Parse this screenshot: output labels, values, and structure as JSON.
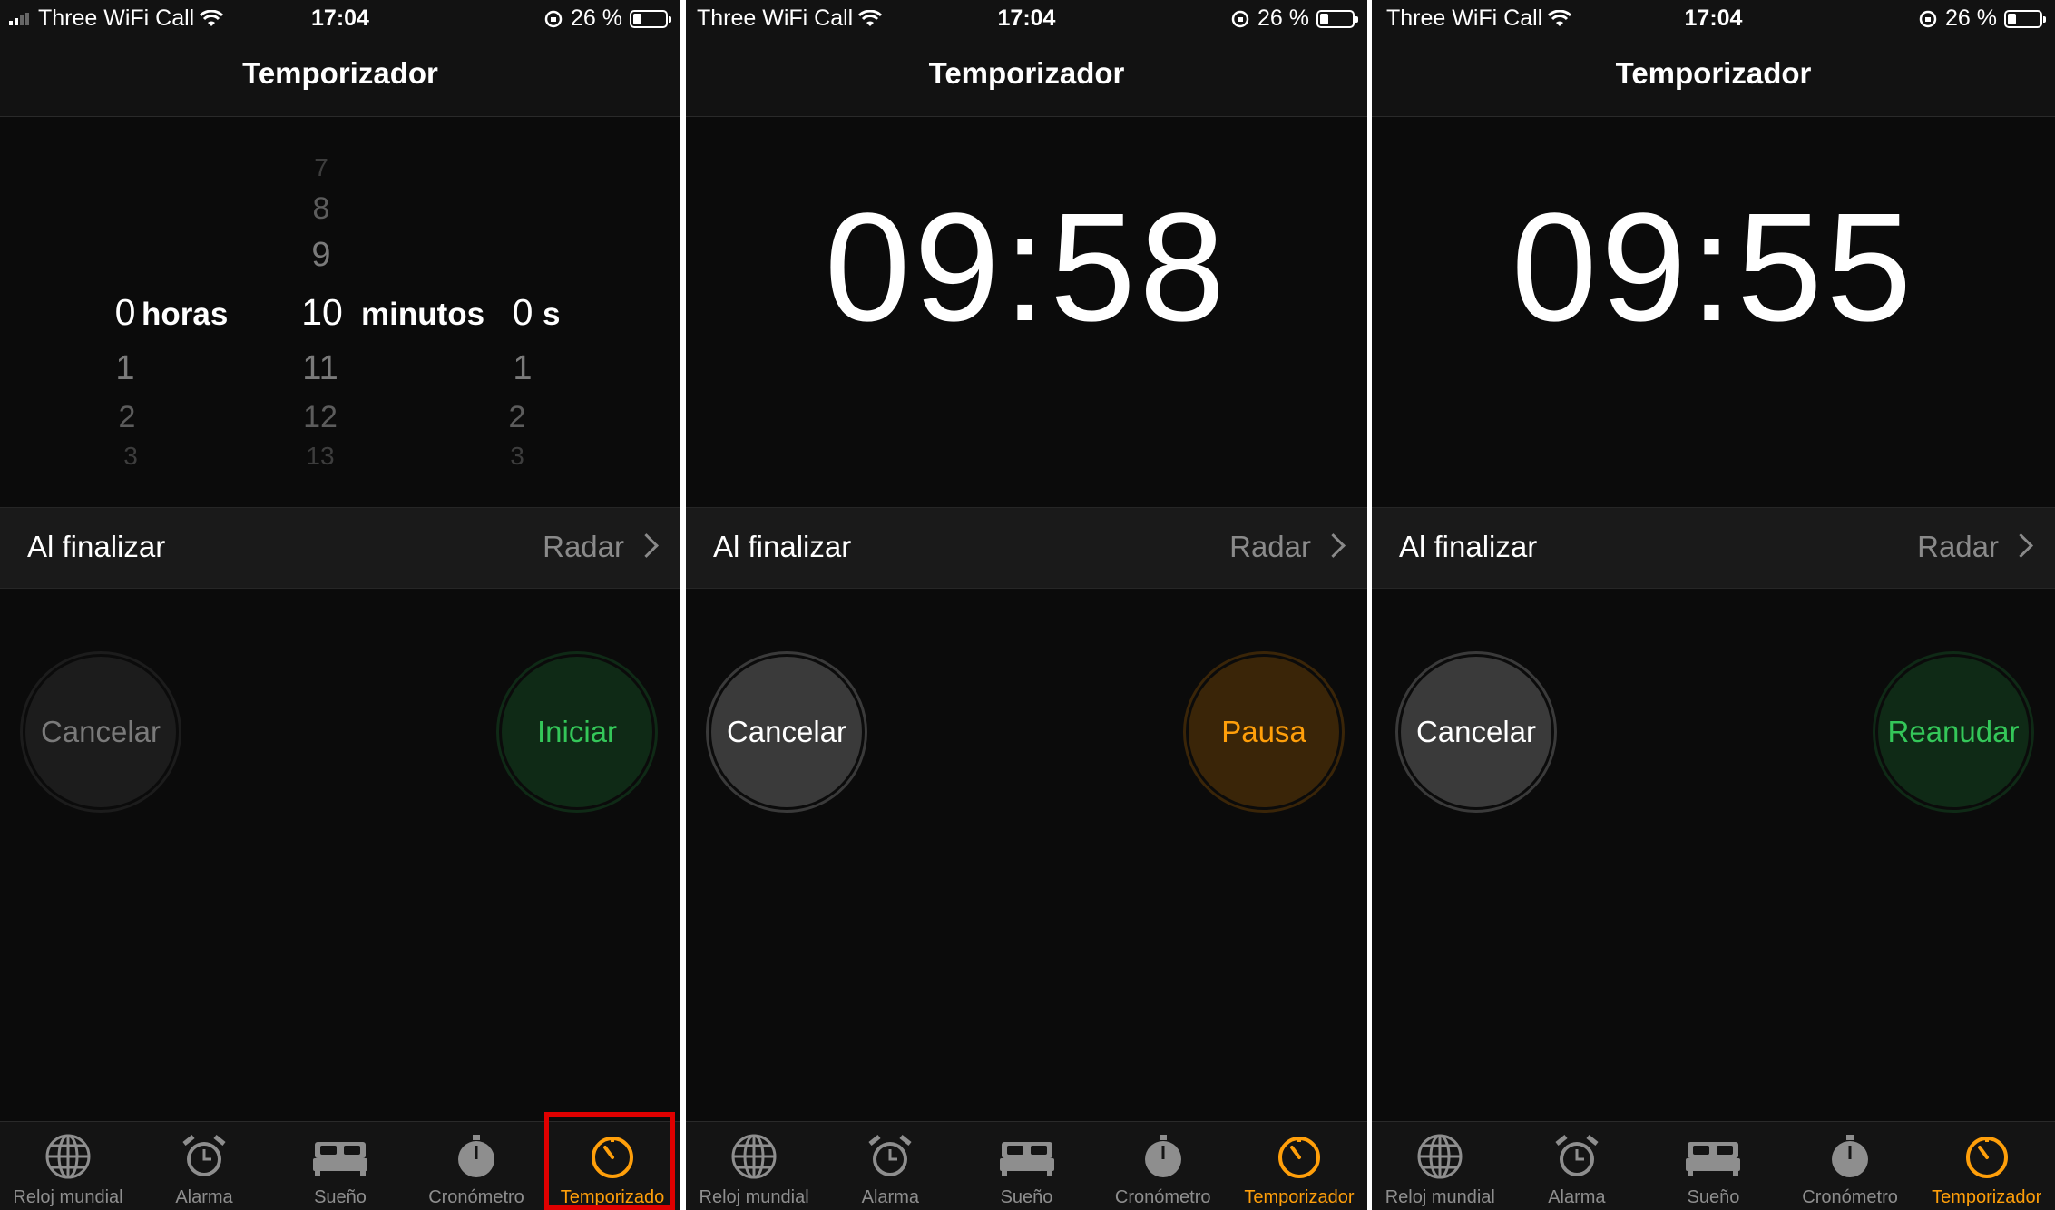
{
  "status": {
    "carrier": "Three WiFi Call",
    "time": "17:04",
    "battery": "26 %"
  },
  "nav_title": "Temporizador",
  "picker": {
    "hours": {
      "above": [
        "",
        "",
        ""
      ],
      "selected": "0",
      "unit": "horas",
      "below": [
        "1",
        "2",
        "3"
      ]
    },
    "minutes": {
      "above": [
        "7",
        "8",
        "9"
      ],
      "selected": "10",
      "unit": "minutos",
      "below": [
        "11",
        "12",
        "13"
      ]
    },
    "seconds": {
      "above": [
        "",
        "",
        ""
      ],
      "selected": "0",
      "unit": "s",
      "below": [
        "1",
        "2",
        "3"
      ]
    }
  },
  "end_row": {
    "label": "Al finalizar",
    "value": "Radar"
  },
  "panels": [
    {
      "cancel": "Cancelar",
      "action": "Iniciar"
    },
    {
      "countdown": "09:58",
      "cancel": "Cancelar",
      "action": "Pausa"
    },
    {
      "countdown": "09:55",
      "cancel": "Cancelar",
      "action": "Reanudar"
    }
  ],
  "tabs": [
    {
      "label": "Reloj mundial",
      "icon": "globe-icon"
    },
    {
      "label": "Alarma",
      "icon": "alarm-clock-icon"
    },
    {
      "label": "Sueño",
      "icon": "bed-icon"
    },
    {
      "label": "Cronómetro",
      "icon": "stopwatch-icon"
    },
    {
      "label": "Temporizador",
      "icon": "timer-icon"
    }
  ],
  "first_panel_active_tab_label": "Temporizado",
  "colors": {
    "accent": "#ff9f0a",
    "green": "#34c759",
    "highlight": "#e00000"
  }
}
